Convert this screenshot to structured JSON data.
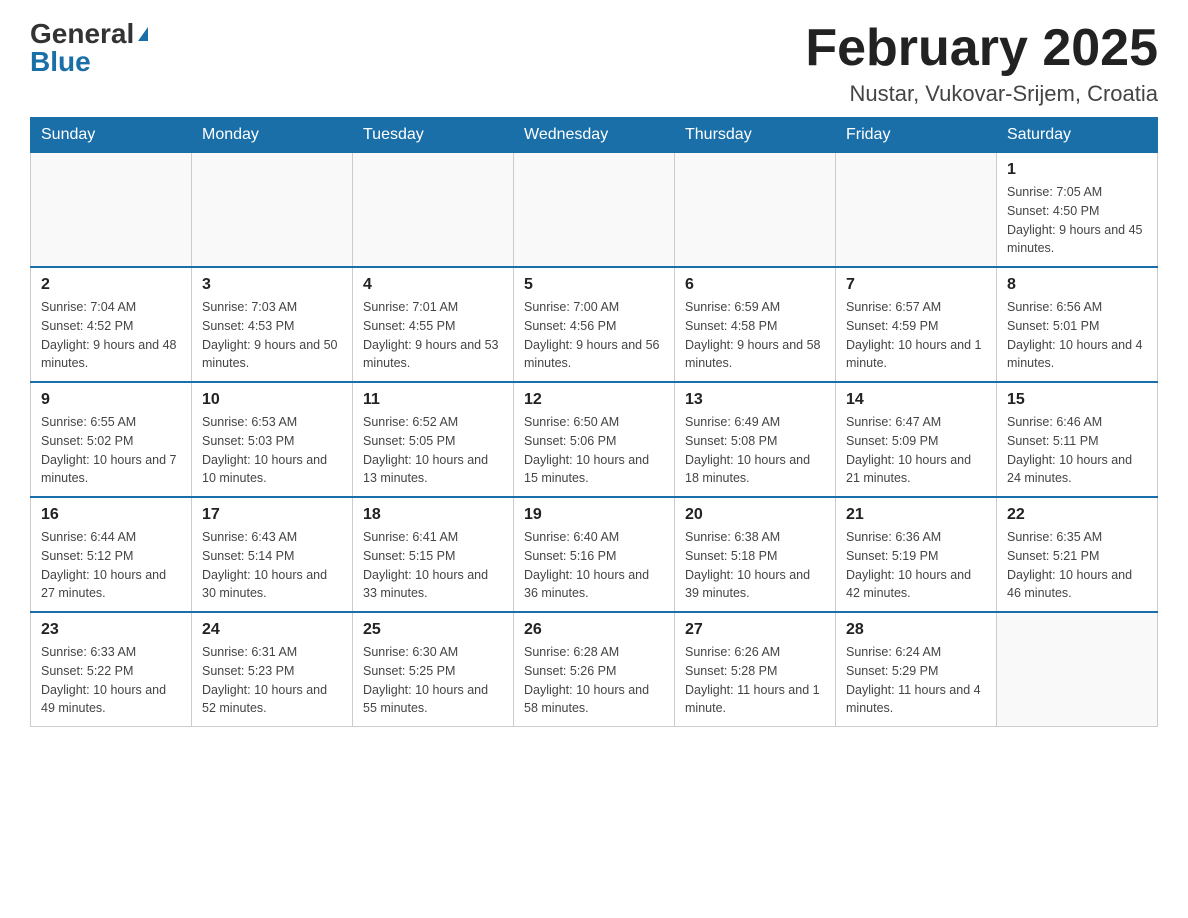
{
  "header": {
    "logo_general": "General",
    "logo_blue": "Blue",
    "month_title": "February 2025",
    "location": "Nustar, Vukovar-Srijem, Croatia"
  },
  "days_of_week": [
    "Sunday",
    "Monday",
    "Tuesday",
    "Wednesday",
    "Thursday",
    "Friday",
    "Saturday"
  ],
  "weeks": [
    [
      {
        "day": "",
        "info": ""
      },
      {
        "day": "",
        "info": ""
      },
      {
        "day": "",
        "info": ""
      },
      {
        "day": "",
        "info": ""
      },
      {
        "day": "",
        "info": ""
      },
      {
        "day": "",
        "info": ""
      },
      {
        "day": "1",
        "info": "Sunrise: 7:05 AM\nSunset: 4:50 PM\nDaylight: 9 hours and 45 minutes."
      }
    ],
    [
      {
        "day": "2",
        "info": "Sunrise: 7:04 AM\nSunset: 4:52 PM\nDaylight: 9 hours and 48 minutes."
      },
      {
        "day": "3",
        "info": "Sunrise: 7:03 AM\nSunset: 4:53 PM\nDaylight: 9 hours and 50 minutes."
      },
      {
        "day": "4",
        "info": "Sunrise: 7:01 AM\nSunset: 4:55 PM\nDaylight: 9 hours and 53 minutes."
      },
      {
        "day": "5",
        "info": "Sunrise: 7:00 AM\nSunset: 4:56 PM\nDaylight: 9 hours and 56 minutes."
      },
      {
        "day": "6",
        "info": "Sunrise: 6:59 AM\nSunset: 4:58 PM\nDaylight: 9 hours and 58 minutes."
      },
      {
        "day": "7",
        "info": "Sunrise: 6:57 AM\nSunset: 4:59 PM\nDaylight: 10 hours and 1 minute."
      },
      {
        "day": "8",
        "info": "Sunrise: 6:56 AM\nSunset: 5:01 PM\nDaylight: 10 hours and 4 minutes."
      }
    ],
    [
      {
        "day": "9",
        "info": "Sunrise: 6:55 AM\nSunset: 5:02 PM\nDaylight: 10 hours and 7 minutes."
      },
      {
        "day": "10",
        "info": "Sunrise: 6:53 AM\nSunset: 5:03 PM\nDaylight: 10 hours and 10 minutes."
      },
      {
        "day": "11",
        "info": "Sunrise: 6:52 AM\nSunset: 5:05 PM\nDaylight: 10 hours and 13 minutes."
      },
      {
        "day": "12",
        "info": "Sunrise: 6:50 AM\nSunset: 5:06 PM\nDaylight: 10 hours and 15 minutes."
      },
      {
        "day": "13",
        "info": "Sunrise: 6:49 AM\nSunset: 5:08 PM\nDaylight: 10 hours and 18 minutes."
      },
      {
        "day": "14",
        "info": "Sunrise: 6:47 AM\nSunset: 5:09 PM\nDaylight: 10 hours and 21 minutes."
      },
      {
        "day": "15",
        "info": "Sunrise: 6:46 AM\nSunset: 5:11 PM\nDaylight: 10 hours and 24 minutes."
      }
    ],
    [
      {
        "day": "16",
        "info": "Sunrise: 6:44 AM\nSunset: 5:12 PM\nDaylight: 10 hours and 27 minutes."
      },
      {
        "day": "17",
        "info": "Sunrise: 6:43 AM\nSunset: 5:14 PM\nDaylight: 10 hours and 30 minutes."
      },
      {
        "day": "18",
        "info": "Sunrise: 6:41 AM\nSunset: 5:15 PM\nDaylight: 10 hours and 33 minutes."
      },
      {
        "day": "19",
        "info": "Sunrise: 6:40 AM\nSunset: 5:16 PM\nDaylight: 10 hours and 36 minutes."
      },
      {
        "day": "20",
        "info": "Sunrise: 6:38 AM\nSunset: 5:18 PM\nDaylight: 10 hours and 39 minutes."
      },
      {
        "day": "21",
        "info": "Sunrise: 6:36 AM\nSunset: 5:19 PM\nDaylight: 10 hours and 42 minutes."
      },
      {
        "day": "22",
        "info": "Sunrise: 6:35 AM\nSunset: 5:21 PM\nDaylight: 10 hours and 46 minutes."
      }
    ],
    [
      {
        "day": "23",
        "info": "Sunrise: 6:33 AM\nSunset: 5:22 PM\nDaylight: 10 hours and 49 minutes."
      },
      {
        "day": "24",
        "info": "Sunrise: 6:31 AM\nSunset: 5:23 PM\nDaylight: 10 hours and 52 minutes."
      },
      {
        "day": "25",
        "info": "Sunrise: 6:30 AM\nSunset: 5:25 PM\nDaylight: 10 hours and 55 minutes."
      },
      {
        "day": "26",
        "info": "Sunrise: 6:28 AM\nSunset: 5:26 PM\nDaylight: 10 hours and 58 minutes."
      },
      {
        "day": "27",
        "info": "Sunrise: 6:26 AM\nSunset: 5:28 PM\nDaylight: 11 hours and 1 minute."
      },
      {
        "day": "28",
        "info": "Sunrise: 6:24 AM\nSunset: 5:29 PM\nDaylight: 11 hours and 4 minutes."
      },
      {
        "day": "",
        "info": ""
      }
    ]
  ]
}
